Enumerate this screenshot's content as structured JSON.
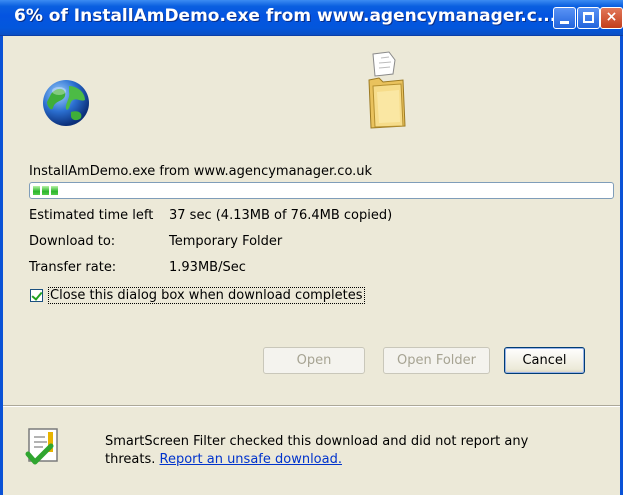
{
  "window": {
    "title": "6% of InstallAmDemo.exe from www.agencymanager.c...",
    "controls": {
      "minimize": "minimize-icon",
      "maximize": "maximize-icon",
      "close": "×"
    }
  },
  "download": {
    "filename": "InstallAmDemo.exe from www.agencymanager.co.uk",
    "progress": 0.06,
    "estimated_label": "Estimated time left",
    "estimated_value": "37 sec (4.13MB of 76.4MB copied)",
    "download_to_label": "Download to:",
    "download_to_value": "Temporary Folder",
    "transfer_rate_label": "Transfer rate:",
    "transfer_rate_value": "1.93MB/Sec",
    "close_when_done": {
      "label": "Close this dialog box when download completes",
      "checked": true
    }
  },
  "buttons": {
    "open": "Open",
    "open_folder": "Open Folder",
    "cancel": "Cancel"
  },
  "smartscreen": {
    "text_before": "SmartScreen Filter checked this download and did not report any threats. ",
    "link": "Report an unsafe download."
  },
  "colors": {
    "titlebar": "#0454e1",
    "client_bg": "#ece9d8",
    "progress_fill": "#2bb52b",
    "link": "#0033cc"
  }
}
